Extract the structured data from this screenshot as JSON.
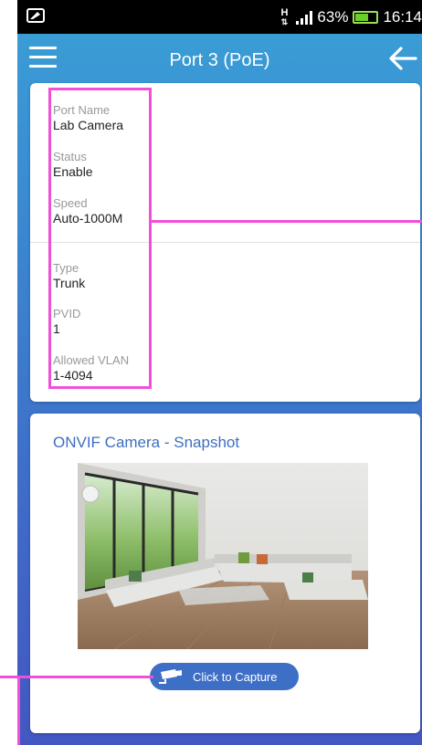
{
  "status_bar": {
    "network_letter": "H",
    "battery_percent": "63%",
    "battery_level": 0.63,
    "time": "16:14"
  },
  "app_bar": {
    "title": "Port 3 (PoE)",
    "menu_icon": "hamburger-menu-icon",
    "back_icon": "back-arrow-icon"
  },
  "port_details": {
    "fields": [
      {
        "label": "Port Name",
        "value": "Lab Camera"
      },
      {
        "label": "Status",
        "value": "Enable"
      },
      {
        "label": "Speed",
        "value": "Auto-1000M"
      },
      {
        "label": "Type",
        "value": "Trunk"
      },
      {
        "label": "PVID",
        "value": "1"
      },
      {
        "label": "Allowed VLAN",
        "value": "1-4094"
      }
    ]
  },
  "snapshot": {
    "title": "ONVIF Camera - Snapshot",
    "capture_label": "Click to Capture",
    "capture_icon": "security-camera-icon"
  },
  "colors": {
    "accent": "#3e6fc6",
    "highlight": "#f24fd8",
    "background_top": "#3aa0d6",
    "background_bottom": "#4357c2"
  }
}
